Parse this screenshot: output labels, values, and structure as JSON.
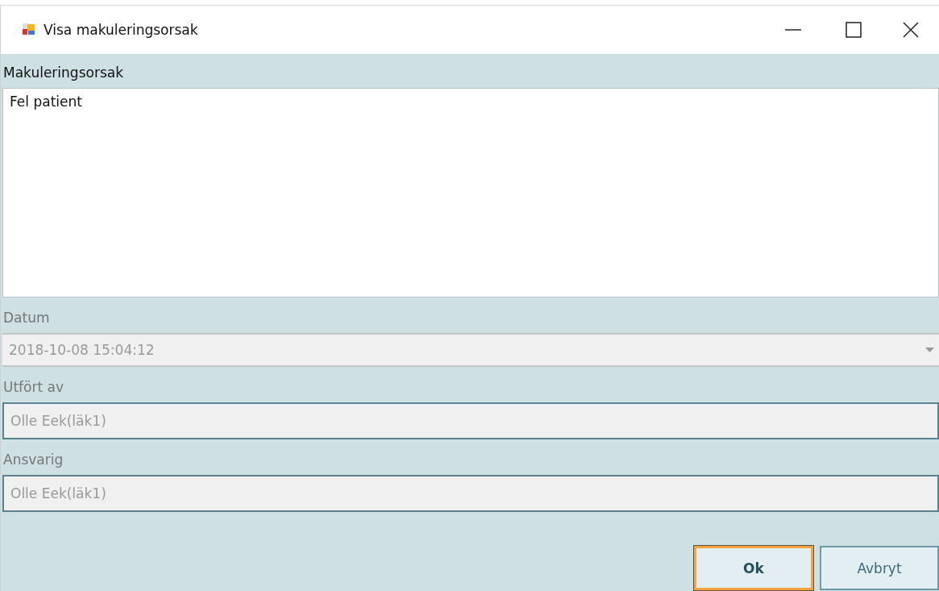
{
  "window": {
    "title": "Visa makuleringsorsak"
  },
  "fields": [
    {
      "kind": "textarea",
      "label": "Makuleringsorsak",
      "value": "Fel patient",
      "disabled": false
    },
    {
      "kind": "combo",
      "label": "Datum",
      "value": "2018-10-08 15:04:12",
      "disabled": true
    },
    {
      "kind": "text",
      "label": "Utfört av",
      "value": "Olle Eek(läk1)",
      "disabled": true
    },
    {
      "kind": "text",
      "label": "Ansvarig",
      "value": "Olle Eek(läk1)",
      "disabled": true
    }
  ],
  "buttons": [
    {
      "label": "Ok",
      "default": true
    },
    {
      "label": "Avbryt",
      "default": false
    }
  ]
}
